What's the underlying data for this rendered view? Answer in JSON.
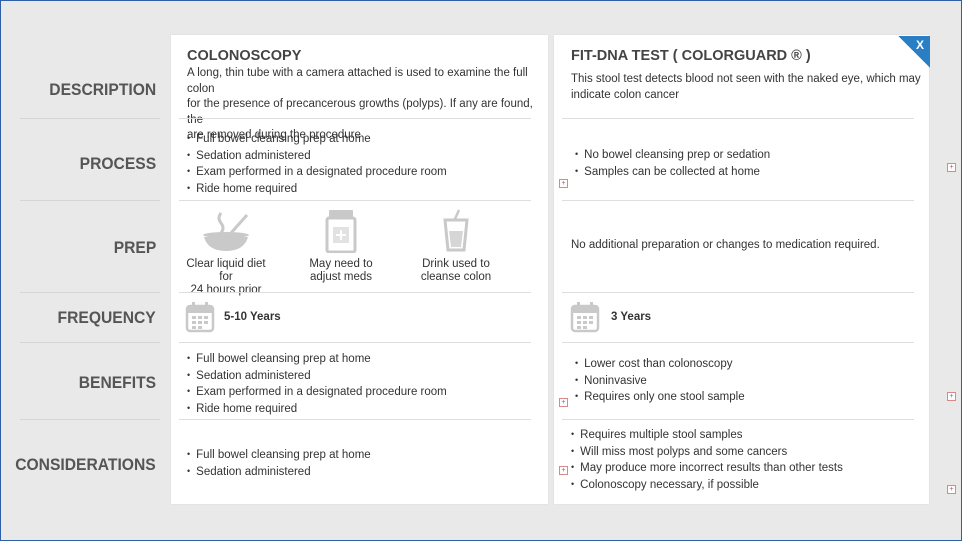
{
  "rows": {
    "description": "DESCRIPTION",
    "process": "PROCESS",
    "prep": "PREP",
    "frequency": "FREQUENCY",
    "benefits": "BENEFITS",
    "considerations": "CONSIDERATIONS"
  },
  "colonoscopy": {
    "title": "COLONOSCOPY",
    "description_lines": [
      "A long, thin tube with a camera attached is used to examine the full colon",
      "for the presence of precancerous growths (polyps).  If any are found, the",
      "are removed during the procedure"
    ],
    "process": [
      "Full bowel cleansing prep at home",
      "Sedation administered",
      "Exam performed in a designated procedure room",
      "Ride home required"
    ],
    "prep": [
      {
        "icon": "soup-bowl-icon",
        "line1": "Clear liquid diet for",
        "line2": "24 hours prior"
      },
      {
        "icon": "medicine-bottle-icon",
        "line1": "May need to",
        "line2": "adjust meds"
      },
      {
        "icon": "drink-cup-icon",
        "line1": "Drink used to",
        "line2": "cleanse colon"
      }
    ],
    "frequency": "5-10 Years",
    "benefits": [
      "Full bowel cleansing prep at home",
      "Sedation administered",
      "Exam performed in a designated procedure room",
      "Ride home required"
    ],
    "considerations": [
      "Full bowel cleansing prep at home",
      "Sedation administered"
    ]
  },
  "fitdna": {
    "title": "FIT-DNA TEST ( COLORGUARD ® )",
    "description_lines": [
      "This stool test detects blood not seen with the naked eye, which may",
      "indicate colon cancer"
    ],
    "process": [
      "No bowel cleansing prep or sedation",
      "Samples can be collected at home"
    ],
    "prep": "No additional preparation or changes to medication required.",
    "frequency": "3 Years",
    "benefits": [
      "Lower cost than colonoscopy",
      "Noninvasive",
      "Requires only one stool sample"
    ],
    "considerations": [
      "Requires multiple stool samples",
      "Will miss most polyps and some cancers",
      "May produce more incorrect results than other tests",
      "Colonoscopy necessary, if possible"
    ]
  },
  "close_label": "X",
  "colors": {
    "accent": "#2a7fc4",
    "label": "#555555",
    "background": "#e9e9e9"
  }
}
